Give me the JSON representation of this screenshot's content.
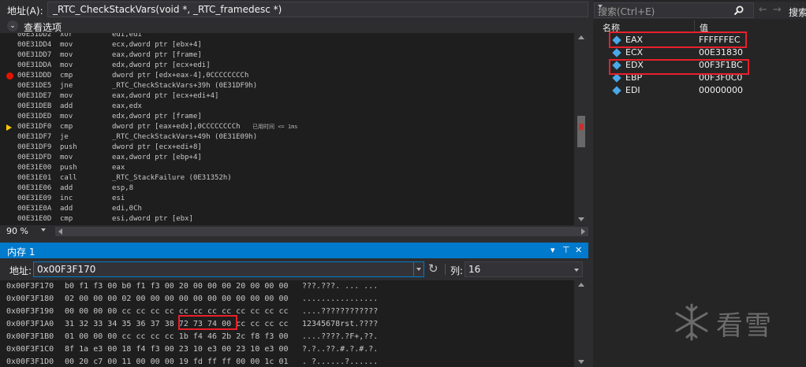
{
  "disassembly": {
    "address_label": "地址(A):",
    "address_value": "_RTC_CheckStackVars(void *, _RTC_framedesc *)",
    "view_options_label": "查看选项",
    "zoom": "90 %",
    "rows": [
      {
        "addr": "00E31DD2",
        "op": "xor",
        "args": "edi,edi",
        "marker": "",
        "note": ""
      },
      {
        "addr": "00E31DD4",
        "op": "mov",
        "args": "ecx,dword ptr [ebx+4]",
        "marker": "",
        "note": ""
      },
      {
        "addr": "00E31DD7",
        "op": "mov",
        "args": "eax,dword ptr [frame]",
        "marker": "",
        "note": ""
      },
      {
        "addr": "00E31DDA",
        "op": "mov",
        "args": "edx,dword ptr [ecx+edi]",
        "marker": "",
        "note": ""
      },
      {
        "addr": "00E31DDD",
        "op": "cmp",
        "args": "dword ptr [edx+eax-4],0CCCCCCCCh",
        "marker": "breakpoint",
        "note": ""
      },
      {
        "addr": "00E31DE5",
        "op": "jne",
        "args": "_RTC_CheckStackVars+39h (0E31DF9h)",
        "marker": "",
        "note": ""
      },
      {
        "addr": "00E31DE7",
        "op": "mov",
        "args": "eax,dword ptr [ecx+edi+4]",
        "marker": "",
        "note": ""
      },
      {
        "addr": "00E31DEB",
        "op": "add",
        "args": "eax,edx",
        "marker": "",
        "note": ""
      },
      {
        "addr": "00E31DED",
        "op": "mov",
        "args": "edx,dword ptr [frame]",
        "marker": "",
        "note": ""
      },
      {
        "addr": "00E31DF0",
        "op": "cmp",
        "args": "dword ptr [eax+edx],0CCCCCCCCh",
        "marker": "current",
        "note": "已用时间 <= 1ms"
      },
      {
        "addr": "00E31DF7",
        "op": "je",
        "args": "_RTC_CheckStackVars+49h (0E31E09h)",
        "marker": "",
        "note": ""
      },
      {
        "addr": "00E31DF9",
        "op": "push",
        "args": "dword ptr [ecx+edi+8]",
        "marker": "",
        "note": ""
      },
      {
        "addr": "00E31DFD",
        "op": "mov",
        "args": "eax,dword ptr [ebp+4]",
        "marker": "",
        "note": ""
      },
      {
        "addr": "00E31E00",
        "op": "push",
        "args": "eax",
        "marker": "",
        "note": ""
      },
      {
        "addr": "00E31E01",
        "op": "call",
        "args": "_RTC_StackFailure (0E31352h)",
        "marker": "",
        "note": ""
      },
      {
        "addr": "00E31E06",
        "op": "add",
        "args": "esp,8",
        "marker": "",
        "note": ""
      },
      {
        "addr": "00E31E09",
        "op": "inc",
        "args": "esi",
        "marker": "",
        "note": ""
      },
      {
        "addr": "00E31E0A",
        "op": "add",
        "args": "edi,0Ch",
        "marker": "",
        "note": ""
      },
      {
        "addr": "00E31E0D",
        "op": "cmp",
        "args": "esi,dword ptr [ebx]",
        "marker": "",
        "note": ""
      }
    ]
  },
  "memory": {
    "title": "内存 1",
    "address_label": "地址:",
    "address_value": "0x00F3F170",
    "columns_label": "列:",
    "columns_value": "16",
    "rows": [
      {
        "addr": "0x00F3F170",
        "bytes": [
          "b0",
          "f1",
          "f3",
          "00",
          "b0",
          "f1",
          "f3",
          "00",
          "20",
          "00",
          "00",
          "00",
          "20",
          "00",
          "00",
          "00"
        ],
        "text": "???.???. ... ..."
      },
      {
        "addr": "0x00F3F180",
        "bytes": [
          "02",
          "00",
          "00",
          "00",
          "02",
          "00",
          "00",
          "00",
          "00",
          "00",
          "00",
          "00",
          "00",
          "00",
          "00",
          "00"
        ],
        "text": "................"
      },
      {
        "addr": "0x00F3F190",
        "bytes": [
          "00",
          "00",
          "00",
          "00",
          "cc",
          "cc",
          "cc",
          "cc",
          "cc",
          "cc",
          "cc",
          "cc",
          "cc",
          "cc",
          "cc",
          "cc"
        ],
        "text": "....????????????"
      },
      {
        "addr": "0x00F3F1A0",
        "bytes": [
          "31",
          "32",
          "33",
          "34",
          "35",
          "36",
          "37",
          "38",
          "72",
          "73",
          "74",
          "00",
          "cc",
          "cc",
          "cc",
          "cc"
        ],
        "text": "12345678rst.????"
      },
      {
        "addr": "0x00F3F1B0",
        "bytes": [
          "01",
          "00",
          "00",
          "00",
          "cc",
          "cc",
          "cc",
          "cc",
          "1b",
          "f4",
          "46",
          "2b",
          "2c",
          "f8",
          "f3",
          "00"
        ],
        "text": "....????.?F+,??."
      },
      {
        "addr": "0x00F3F1C0",
        "bytes": [
          "8f",
          "1a",
          "e3",
          "00",
          "18",
          "f4",
          "f3",
          "00",
          "23",
          "10",
          "e3",
          "00",
          "23",
          "10",
          "e3",
          "00"
        ],
        "text": "?.?..??.#.?.#.?."
      },
      {
        "addr": "0x00F3F1D0",
        "bytes": [
          "00",
          "20",
          "c7",
          "00",
          "11",
          "00",
          "00",
          "00",
          "19",
          "fd",
          "ff",
          "ff",
          "00",
          "00",
          "1c",
          "01"
        ],
        "text": ". ?......?......"
      }
    ]
  },
  "registers": {
    "search_placeholder": "搜索(Ctrl+E)",
    "depth_label": "搜索",
    "col_name": "名称",
    "col_value": "值",
    "items": [
      {
        "name": "EAX",
        "value": "FFFFFFEC"
      },
      {
        "name": "ECX",
        "value": "00E31830"
      },
      {
        "name": "EDX",
        "value": "00F3F1BC"
      },
      {
        "name": "EBP",
        "value": "00F3F0C0"
      },
      {
        "name": "EDI",
        "value": "00000000"
      }
    ]
  },
  "watermark": {
    "text": "看雪"
  },
  "colors": {
    "accent": "#007acc",
    "highlight": "#e8202a",
    "breakpoint": "#e51400",
    "ip_arrow": "#ffcc00"
  }
}
